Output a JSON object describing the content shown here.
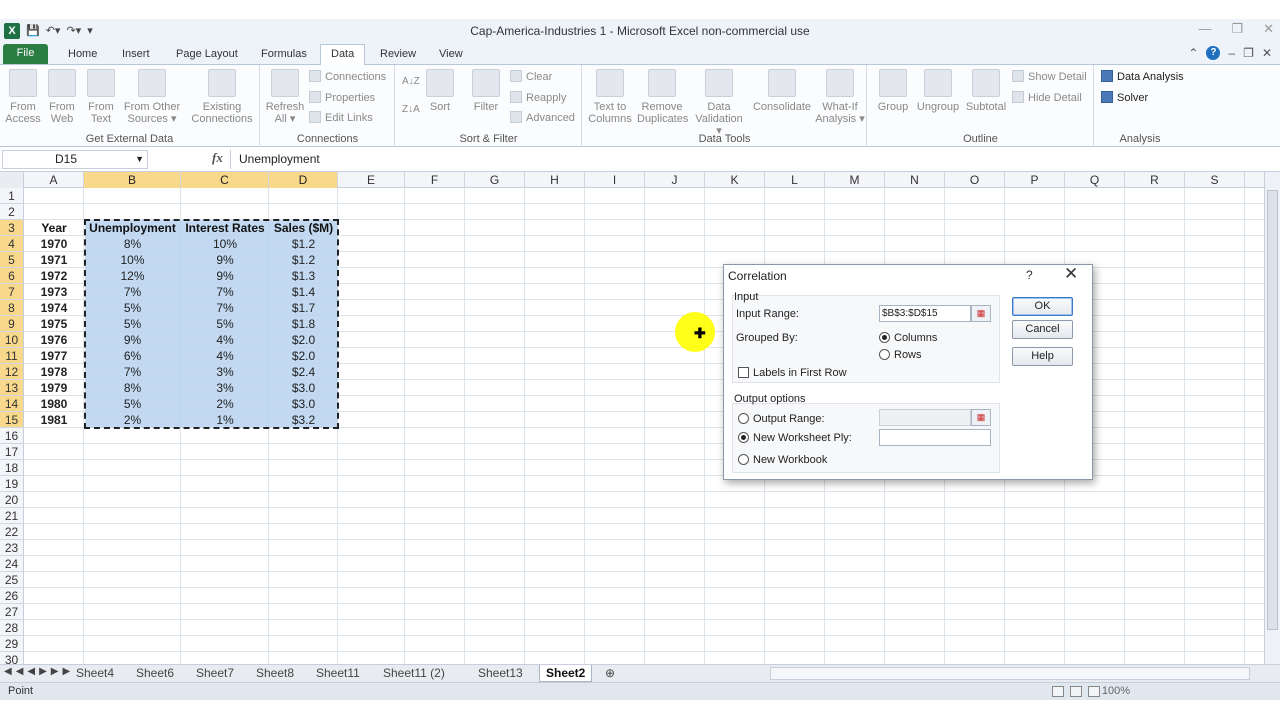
{
  "window": {
    "title": "Cap-America-Industries 1  -  Microsoft Excel non-commercial use",
    "logo_letter": "X"
  },
  "tabs": [
    "File",
    "Home",
    "Insert",
    "Page Layout",
    "Formulas",
    "Data",
    "Review",
    "View"
  ],
  "ribbon": {
    "get_external": {
      "label": "Get External Data",
      "from_access": [
        "From",
        "Access"
      ],
      "from_web": [
        "From",
        "Web"
      ],
      "from_text": [
        "From",
        "Text"
      ],
      "from_other": [
        "From Other",
        "Sources ▾"
      ],
      "existing": [
        "Existing",
        "Connections"
      ]
    },
    "connections": {
      "label": "Connections",
      "refresh": [
        "Refresh",
        "All ▾"
      ],
      "connections": "Connections",
      "properties": "Properties",
      "edit_links": "Edit Links"
    },
    "sort_filter": {
      "label": "Sort & Filter",
      "sort_az": "A↓Z",
      "sort_za": "Z↓A",
      "sort": "Sort",
      "filter": "Filter",
      "clear": "Clear",
      "reapply": "Reapply",
      "advanced": "Advanced"
    },
    "data_tools": {
      "label": "Data Tools",
      "text_to_columns": [
        "Text to",
        "Columns"
      ],
      "remove_duplicates": [
        "Remove",
        "Duplicates"
      ],
      "data_validation": [
        "Data",
        "Validation ▾"
      ],
      "consolidate": "Consolidate",
      "what_if": [
        "What-If",
        "Analysis ▾"
      ]
    },
    "outline": {
      "label": "Outline",
      "group": "Group",
      "ungroup": "Ungroup",
      "subtotal": "Subtotal",
      "show_detail": "Show Detail",
      "hide_detail": "Hide Detail"
    },
    "analysis": {
      "label": "Analysis",
      "data_analysis": "Data Analysis",
      "solver": "Solver"
    }
  },
  "formula_bar": {
    "name_box": "D15",
    "fx": "fx",
    "value": "Unemployment"
  },
  "grid": {
    "columns": [
      "A",
      "B",
      "C",
      "D",
      "E",
      "F",
      "G",
      "H",
      "I",
      "J",
      "K",
      "L",
      "M",
      "N",
      "O",
      "P",
      "Q",
      "R",
      "S"
    ],
    "rows": [
      "1",
      "2",
      "3",
      "4",
      "5",
      "6",
      "7",
      "8",
      "9",
      "10",
      "11",
      "12",
      "13",
      "14",
      "15",
      "16",
      "17",
      "18",
      "19",
      "20",
      "21",
      "22",
      "23",
      "24",
      "25",
      "26",
      "27",
      "28",
      "29",
      "30"
    ],
    "table_headers": [
      "Year",
      "Unemployment",
      "Interest Rates",
      "Sales ($M)"
    ],
    "table_rows": [
      [
        "1970",
        "8%",
        "10%",
        "$1.2"
      ],
      [
        "1971",
        "10%",
        "9%",
        "$1.2"
      ],
      [
        "1972",
        "12%",
        "9%",
        "$1.3"
      ],
      [
        "1973",
        "7%",
        "7%",
        "$1.4"
      ],
      [
        "1974",
        "5%",
        "7%",
        "$1.7"
      ],
      [
        "1975",
        "5%",
        "5%",
        "$1.8"
      ],
      [
        "1976",
        "9%",
        "4%",
        "$2.0"
      ],
      [
        "1977",
        "6%",
        "4%",
        "$2.0"
      ],
      [
        "1978",
        "7%",
        "3%",
        "$2.4"
      ],
      [
        "1979",
        "8%",
        "3%",
        "$3.0"
      ],
      [
        "1980",
        "5%",
        "2%",
        "$3.0"
      ],
      [
        "1981",
        "2%",
        "1%",
        "$3.2"
      ]
    ]
  },
  "sheet_tabs": [
    "Sheet4",
    "Sheet6",
    "Sheet7",
    "Sheet8",
    "Sheet11",
    "Sheet11 (2)",
    "Sheet13",
    "Sheet2"
  ],
  "active_sheet": "Sheet2",
  "status": {
    "mode": "Point",
    "zoom": "100%"
  },
  "dialog": {
    "title": "Correlation",
    "help": "?",
    "close": "✕",
    "input_section": "Input",
    "input_range_label": "Input Range:",
    "input_range_value": "$B$3:$D$15",
    "grouped_by_label": "Grouped By:",
    "columns": "Columns",
    "rows": "Rows",
    "labels_first_row": "Labels in First Row",
    "output_section": "Output options",
    "output_range": "Output Range:",
    "new_worksheet": "New Worksheet Ply:",
    "new_workbook": "New Workbook",
    "ok": "OK",
    "cancel": "Cancel",
    "help_btn": "Help"
  },
  "colors": {
    "selection": "#b7d2ee",
    "header_highlight": "#f8d98c",
    "file_tab": "#2b7d44"
  }
}
